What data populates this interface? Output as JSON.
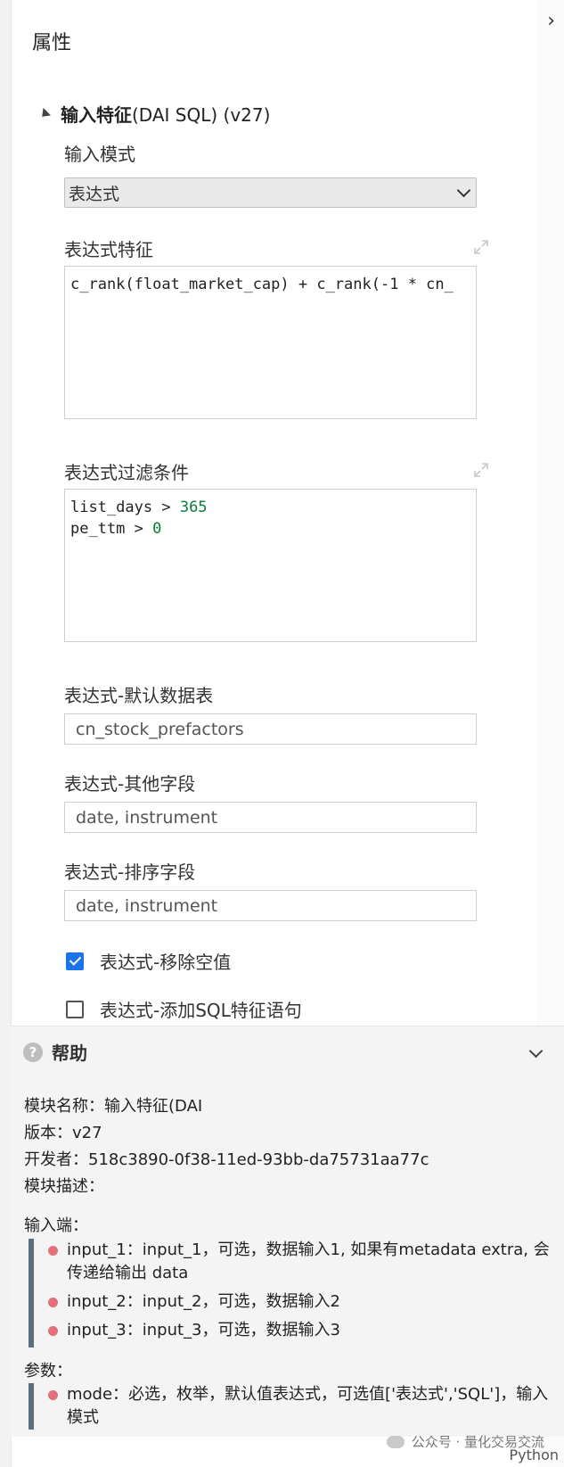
{
  "panel": {
    "title": "属性"
  },
  "section": {
    "title_bold": "输入特征",
    "title_rest": "(DAI SQL) (v27)"
  },
  "fields": {
    "input_mode": {
      "label": "输入模式",
      "value": "表达式"
    },
    "expr_features": {
      "label": "表达式特征",
      "code": "c_rank(float_market_cap) + c_rank(-1 * cn_"
    },
    "expr_filter": {
      "label": "表达式过滤条件",
      "line1_text": "list_days > ",
      "line1_num": "365",
      "line2_text": "pe_ttm > ",
      "line2_num": "0"
    },
    "default_table": {
      "label": "表达式-默认数据表",
      "value": "cn_stock_prefactors"
    },
    "other_fields": {
      "label": "表达式-其他字段",
      "value": "date, instrument"
    },
    "sort_fields": {
      "label": "表达式-排序字段",
      "value": "date, instrument"
    },
    "remove_nulls": {
      "label": "表达式-移除空值",
      "checked": true
    },
    "add_sql": {
      "label": "表达式-添加SQL特征语句",
      "checked": false
    }
  },
  "help": {
    "title": "帮助",
    "module_name": "模块名称：输入特征(DAI",
    "version": "版本：v27",
    "developer": "开发者：518c3890-0f38-11ed-93bb-da75731aa77c",
    "description": "模块描述：",
    "inputs_title": "输入端：",
    "inputs": [
      "input_1：input_1，可选，数据输入1, 如果有metadata extra, 会传递给输出 data",
      "input_2：input_2，可选，数据输入2",
      "input_3：input_3，可选，数据输入3"
    ],
    "params_title": "参数：",
    "params": [
      "mode：必选，枚举，默认值表达式，可选值['表达式','SQL']，输入模式"
    ]
  },
  "watermark": {
    "text": "公众号 · 量化交易交流",
    "lang": "Python"
  },
  "colors": {
    "checkbox_on": "#1a73e8",
    "bullet": "#e2707a",
    "numbers": "#0b7a3b",
    "help_bar": "#5d6d7e"
  },
  "icons": [
    "collapse-chevron-icon",
    "expand-icon",
    "question-icon",
    "chevron-down-icon",
    "wechat-icon"
  ]
}
